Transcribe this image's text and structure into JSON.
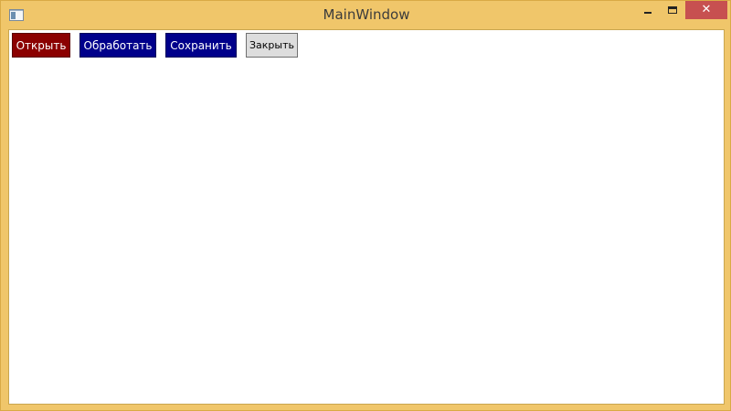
{
  "window": {
    "title": "MainWindow",
    "icon": "app-window-icon",
    "controls": {
      "minimize": "minimize-icon",
      "maximize": "maximize-icon",
      "close_glyph": "✕"
    }
  },
  "toolbar": {
    "open_label": "Открыть",
    "process_label": "Обработать",
    "save_label": "Сохранить",
    "close_label": "Закрыть"
  },
  "colors": {
    "frame": "#f0c66a",
    "close_button": "#c75050",
    "open_button": "#8b0000",
    "process_button": "#00008b",
    "save_button": "#00008b",
    "close_app_button": "#dddddd"
  }
}
